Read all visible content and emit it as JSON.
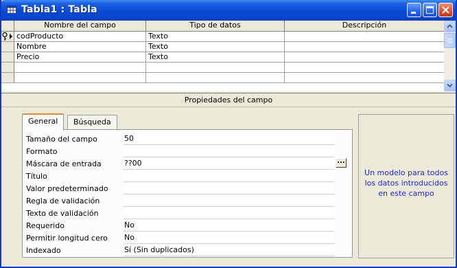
{
  "window": {
    "title": "Tabla1 : Tabla"
  },
  "grid": {
    "columns": [
      "Nombre del campo",
      "Tipo de datos",
      "Descripción"
    ],
    "rows": [
      {
        "name": "codProducto",
        "type": "Texto",
        "description": "",
        "primary_key": true,
        "current": true
      },
      {
        "name": "Nombre",
        "type": "Texto",
        "description": ""
      },
      {
        "name": "Precio",
        "type": "Texto",
        "description": ""
      },
      {
        "name": "",
        "type": "",
        "description": ""
      },
      {
        "name": "",
        "type": "",
        "description": ""
      }
    ]
  },
  "properties": {
    "header": "Propiedades del campo",
    "tabs": [
      {
        "label": "General",
        "active": true
      },
      {
        "label": "Búsqueda",
        "active": false
      }
    ],
    "fields": [
      {
        "label": "Tamaño del campo",
        "value": "50"
      },
      {
        "label": "Formato",
        "value": ""
      },
      {
        "label": "Máscara de entrada",
        "value": "??00",
        "build_button": "..."
      },
      {
        "label": "Título",
        "value": ""
      },
      {
        "label": "Valor predeterminado",
        "value": ""
      },
      {
        "label": "Regla de validación",
        "value": ""
      },
      {
        "label": "Texto de validación",
        "value": ""
      },
      {
        "label": "Requerido",
        "value": "No"
      },
      {
        "label": "Permitir longitud cero",
        "value": "No"
      },
      {
        "label": "Indexado",
        "value": "Sí (Sin duplicados)"
      }
    ],
    "help_text": "Un modelo para todos los datos introducidos en este campo"
  },
  "colors": {
    "titlebar": "#0a4ad6",
    "help_text": "#1a2bd6",
    "active_tab_accent": "#e68b2c",
    "face": "#ece9d8"
  }
}
